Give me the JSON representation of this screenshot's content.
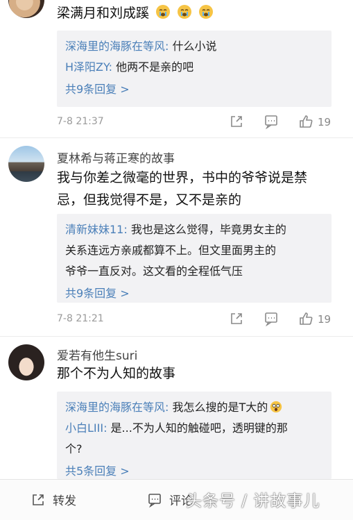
{
  "comments": [
    {
      "text": "梁满月和刘成蹊",
      "emoji_icons": [
        "crying-face-icon",
        "crying-face-icon",
        "crying-face-icon"
      ],
      "replies": [
        {
          "user": "深海里的海豚在等风:",
          "text": " 什么小说"
        },
        {
          "user": "H泽阳ZY:",
          "text": " 他两不是亲的吧"
        }
      ],
      "more": "共9条回复 >",
      "time": "7-8 21:37",
      "likes": "19"
    },
    {
      "name": "夏林希与蒋正寒的故事",
      "text_lines": [
        "我与你差之微毫的世界，书中的爷爷说是禁",
        "忌，但我觉得不是，又不是亲的"
      ],
      "replies": [
        {
          "user": "清新妹妹11:",
          "lines": [
            " 我也是这么觉得，毕竟男女主的",
            "关系连远方亲戚都算不上。但文里面男主的",
            "爷爷一直反对。这文看的全程低气压"
          ]
        }
      ],
      "more": "共9条回复 >",
      "time": "7-8 21:21",
      "likes": "19"
    },
    {
      "name": "爱若有他生suri",
      "text": "那个不为人知的故事",
      "replies": [
        {
          "user": "深海里的海豚在等风:",
          "text": " 我怎么搜的是T大的"
        },
        {
          "user": "小白LIII:",
          "lines": [
            " 是...不为人知的触碰吧，透明键的那",
            "个?"
          ]
        }
      ],
      "more": "共5条回复 >"
    }
  ],
  "bottom_bar": {
    "forward": "转发",
    "comment": "评论"
  },
  "watermark": "头条号 / 讲故事儿",
  "colors": {
    "link": "#4a7fb8",
    "reply_bg": "#f2f2f4",
    "meta": "#9a9a9a"
  }
}
